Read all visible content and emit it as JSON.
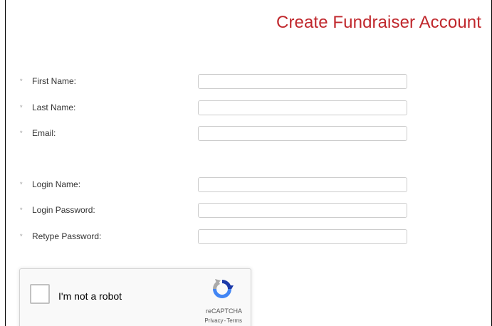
{
  "page": {
    "title": "Create Fundraiser Account",
    "accent_color": "#c0282d"
  },
  "form": {
    "required_marker": "*",
    "fields": [
      {
        "label": "First Name:",
        "value": ""
      },
      {
        "label": "Last Name:",
        "value": ""
      },
      {
        "label": "Email:",
        "value": ""
      },
      {
        "label": "Login Name:",
        "value": ""
      },
      {
        "label": "Login Password:",
        "value": ""
      },
      {
        "label": "Retype Password:",
        "value": ""
      }
    ]
  },
  "recaptcha": {
    "checkbox_label": "I'm not a robot",
    "checked": false,
    "brand": "reCAPTCHA",
    "privacy": "Privacy",
    "separator": "-",
    "terms": "Terms",
    "icon": "recaptcha-logo-icon"
  }
}
